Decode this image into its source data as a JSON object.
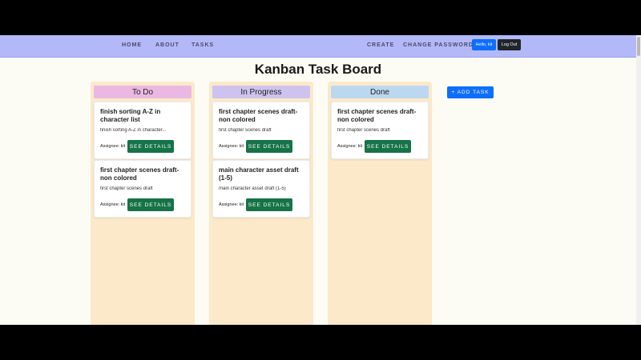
{
  "nav": {
    "links": [
      "HOME",
      "ABOUT",
      "TASKS"
    ],
    "right_links": [
      "CREATE",
      "CHANGE PASSWORD"
    ],
    "hello_label": "Hello, kit",
    "logout_label": "Log Out"
  },
  "page_title": "Kanban Task Board",
  "add_task_label": "+ ADD TASK",
  "columns": [
    {
      "title": "To Do",
      "color": "#eab8e2",
      "cards": [
        {
          "title": "finish sorting A-Z in character list",
          "desc": "finish sorting A-Z in character...",
          "assignee": "Assignee: kit",
          "button": "SEE DETAILS"
        },
        {
          "title": "first chapter scenes draft- non colored",
          "desc": "first chapter scenes draft",
          "assignee": "Assignee: kit",
          "button": "SEE DETAILS"
        }
      ]
    },
    {
      "title": "In Progress",
      "color": "#cdc3ee",
      "cards": [
        {
          "title": "first chapter scenes draft- non colored",
          "desc": "first chapter scenes draft",
          "assignee": "Assignee: kit",
          "button": "SEE DETAILS"
        },
        {
          "title": "main character asset draft (1-5)",
          "desc": "main character asset draft (1-5)",
          "assignee": "Assignee: kit",
          "button": "SEE DETAILS"
        }
      ]
    },
    {
      "title": "Done",
      "color": "#bcd8f0",
      "cards": [
        {
          "title": "first chapter scenes draft- non colored",
          "desc": "first chapter scenes draft",
          "assignee": "Assignee: kit",
          "button": "SEE DETAILS"
        }
      ]
    }
  ]
}
